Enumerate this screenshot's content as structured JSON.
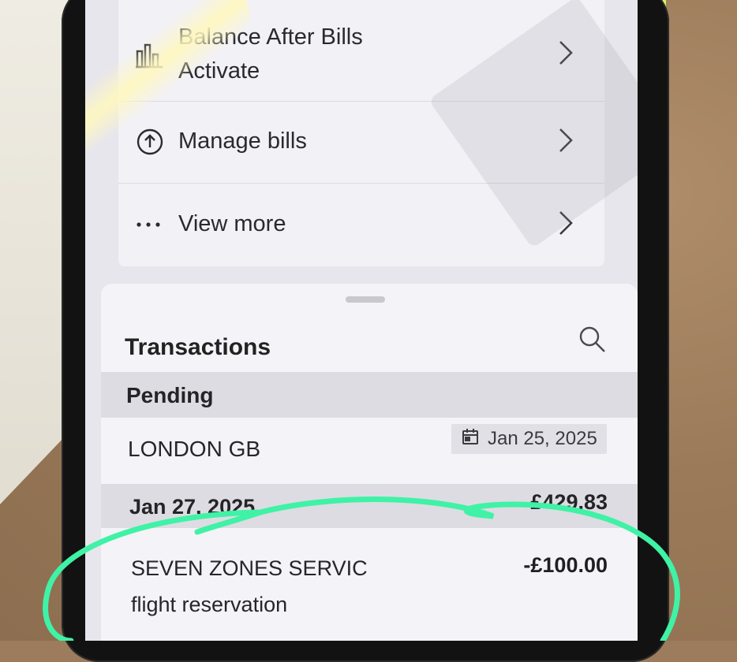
{
  "menu": {
    "items": [
      {
        "icon": "bar-chart-icon",
        "label": "Balance After Bills",
        "sublabel": "Activate"
      },
      {
        "icon": "upload-circle-icon",
        "label": "Manage bills"
      },
      {
        "icon": "more-dots-icon",
        "label": "View more"
      }
    ]
  },
  "transactions": {
    "title": "Transactions",
    "pending": {
      "header": "Pending",
      "merchant": "LONDON GB",
      "date": "Jan 25, 2025"
    },
    "date_group": {
      "date": "Jan 27, 2025",
      "balance": "£429.83"
    },
    "item": {
      "merchant": "SEVEN ZONES SERVIC",
      "description": "flight reservation",
      "amount": "-£100.00"
    }
  },
  "colors": {
    "annotation": "#3ff2a6",
    "glare": "#fff5b8"
  }
}
